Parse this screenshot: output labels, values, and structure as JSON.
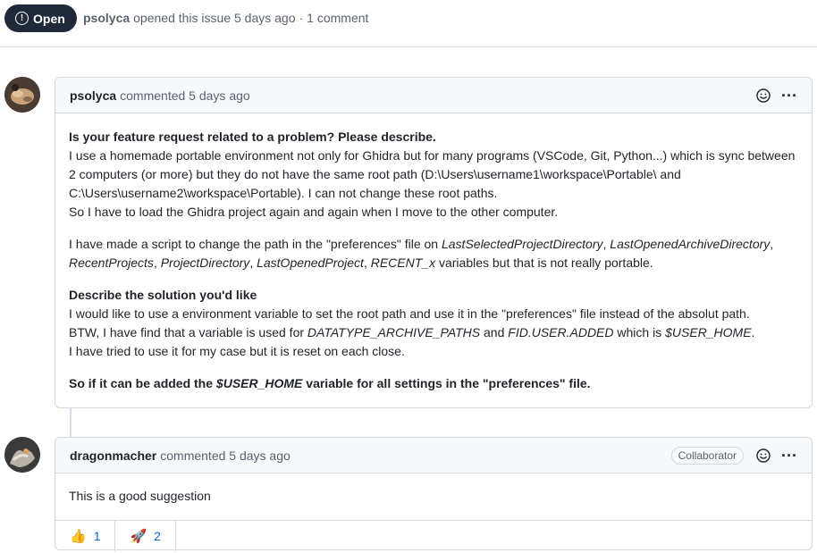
{
  "issue": {
    "state_label": "Open",
    "author": "psolyca",
    "opened_text": "opened this issue 5 days ago",
    "separator": "·",
    "comment_count": "1 comment"
  },
  "comments": [
    {
      "author": "psolyca",
      "action": "commented 5 days ago",
      "body": {
        "q1_heading": "Is your feature request related to a problem? Please describe.",
        "q1_line1": "I use a homemade portable environment not only for Ghidra but for many programs (VSCode, Git, Python...) which is sync between 2 computers (or more) but they do not have the same root path (D:\\Users\\username1\\workspace\\Portable\\ and C:\\Users\\username2\\workspace\\Portable). I can not change these root paths.",
        "q1_line2": "So I have to load the Ghidra project again and again when I move to the other computer.",
        "p2_a": "I have made a script to change the path in the \"preferences\" file on ",
        "p2_v1": "LastSelectedProjectDirectory",
        "p2_sep1": ", ",
        "p2_v2": "LastOpenedArchiveDirectory",
        "p2_sep2": ", ",
        "p2_v3": "RecentProjects",
        "p2_sep3": ", ",
        "p2_v4": "ProjectDirectory",
        "p2_sep4": ", ",
        "p2_v5": "LastOpenedProject",
        "p2_sep5": ", ",
        "p2_v6": "RECENT_x",
        "p2_b": " variables but that is not really portable.",
        "q2_heading": "Describe the solution you'd like",
        "q2_line1": "I would like to use a environment variable to set the root path and use it in the \"preferences\" file instead of the absolut path.",
        "q2_line2_a": "BTW, I have find that a variable is used for ",
        "q2_line2_v1": "DATATYPE_ARCHIVE_PATHS",
        "q2_line2_b": " and ",
        "q2_line2_v2": "FID.USER.ADDED",
        "q2_line2_c": " which is ",
        "q2_line2_v3": "$USER_HOME",
        "q2_line2_d": ".",
        "q2_line3": "I have tried to use it for my case but it is reset on each close.",
        "final_a": "So if it can be added the ",
        "final_v": "$USER_HOME",
        "final_b": " variable for all settings in the \"preferences\" file."
      }
    },
    {
      "author": "dragonmacher",
      "action": "commented 5 days ago",
      "role": "Collaborator",
      "body_text": "This is a good suggestion",
      "reactions": [
        {
          "icon": "thumbs-up-icon",
          "emoji": "👍",
          "count": "1"
        },
        {
          "icon": "rocket-icon",
          "emoji": "🚀",
          "count": "2"
        }
      ]
    }
  ],
  "colors": {
    "badge_bg": "#1f2937",
    "header_bg": "#f6f8fa",
    "border": "#d1d9e0",
    "link": "#0969da",
    "muted": "#59636e"
  }
}
